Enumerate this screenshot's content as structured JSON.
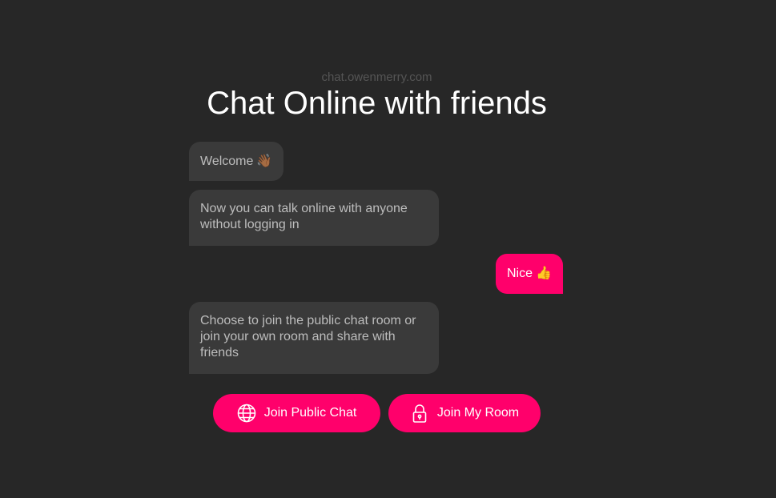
{
  "header": {
    "site_url": "chat.owenmerry.com",
    "title": "Chat Online with friends"
  },
  "messages": [
    {
      "side": "left",
      "text": "Welcome",
      "emoji": "👋🏾"
    },
    {
      "side": "left",
      "text": "Now you can talk online with anyone without logging in",
      "emoji": ""
    },
    {
      "side": "right",
      "text": "Nice",
      "emoji": "👍"
    },
    {
      "side": "left",
      "text": "Choose to join the public chat room or join your own room and share with friends",
      "emoji": ""
    }
  ],
  "actions": {
    "public_chat": {
      "label": "Join Public Chat",
      "icon": "globe-icon"
    },
    "my_room": {
      "label": "Join My Room",
      "icon": "lock-icon"
    }
  },
  "colors": {
    "background": "#272727",
    "accent": "#ff006b",
    "bubble": "#3a3a3a",
    "bubble_text": "#bdbdbd",
    "url_text": "#555555"
  }
}
